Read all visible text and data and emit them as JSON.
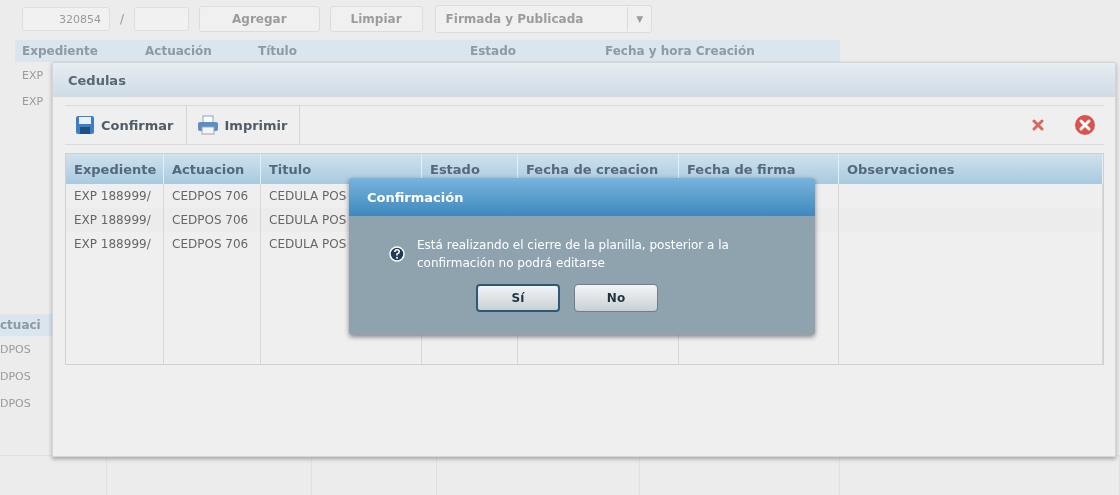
{
  "background_page": {
    "toolbar": {
      "number_field": "320854",
      "separator": "/",
      "buttons": [
        "Agregar",
        "Limpiar"
      ],
      "status_select": {
        "value": "Firmada y Publicada",
        "arrow": "▼"
      }
    },
    "table": {
      "columns": [
        "Expediente",
        "Actuación",
        "Título",
        "Estado",
        "Fecha y hora Creación"
      ],
      "rows": [
        [
          "EXP"
        ],
        [
          "EXP"
        ]
      ]
    },
    "lower_table": {
      "columns": [
        "ctuaci"
      ],
      "rows": [
        [
          "DPOS"
        ],
        [
          "DPOS"
        ],
        [
          "DPOS"
        ]
      ]
    }
  },
  "cedulas_window": {
    "title": "Cedulas",
    "toolbar": [
      {
        "label": "Confirmar",
        "kind": "save"
      },
      {
        "label": "Imprimir",
        "kind": "print"
      }
    ],
    "table": {
      "columns": [
        "Expediente",
        "Actuacion",
        "Titulo",
        "Estado",
        "Fecha de creacion",
        "Fecha de firma",
        "Observaciones"
      ],
      "rows": [
        [
          "EXP 188999/",
          "CEDPOS 706",
          "CEDULA POS"
        ],
        [
          "EXP 188999/",
          "CEDPOS 706",
          "CEDULA POS"
        ],
        [
          "EXP 188999/",
          "CEDPOS 706",
          "CEDULA POS"
        ]
      ]
    }
  },
  "confirm_dialog": {
    "title": "Confirmación",
    "message": "Está realizando el cierre de la planilla, posterior a la confirmación no podrá editarse",
    "buttons": [
      {
        "label": "Sí",
        "focused": true
      },
      {
        "label": "No",
        "focused": false
      }
    ]
  }
}
